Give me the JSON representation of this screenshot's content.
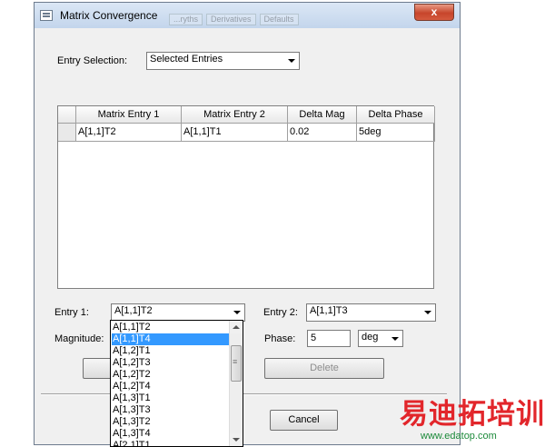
{
  "window": {
    "title": "Matrix Convergence",
    "close_glyph": "x",
    "background_tabs": [
      "...ryths",
      "Derivatives",
      "Defaults"
    ]
  },
  "entry_selection": {
    "label": "Entry Selection:",
    "value": "Selected Entries"
  },
  "grid": {
    "columns": [
      "Matrix Entry 1",
      "Matrix Entry 2",
      "Delta Mag",
      "Delta Phase"
    ],
    "rows": [
      [
        "A[1,1]T2",
        "A[1,1]T1",
        "0.02",
        "5deg"
      ]
    ]
  },
  "entry1": {
    "label": "Entry 1:",
    "value": "A[1,1]T2",
    "options": [
      "A[1,1]T2",
      "A[1,1]T4",
      "A[1,2]T1",
      "A[1,2]T3",
      "A[1,2]T2",
      "A[1,2]T4",
      "A[1,3]T1",
      "A[1,3]T3",
      "A[1,3]T2",
      "A[1,3]T4",
      "A[2,1]T1"
    ],
    "highlighted": "A[1,1]T4"
  },
  "entry2": {
    "label": "Entry 2:",
    "value": "A[1,1]T3"
  },
  "magnitude": {
    "label": "Magnitude:"
  },
  "phase": {
    "label": "Phase:",
    "value": "5",
    "unit": "deg"
  },
  "buttons": {
    "delete": "Delete",
    "cancel": "Cancel"
  },
  "watermark": {
    "text": "易迪拓培训",
    "url": "www.edatop.com"
  },
  "colors": {
    "selection": "#3399ff",
    "watermark_red": "#e2262b",
    "watermark_green": "#1c8a3a"
  }
}
